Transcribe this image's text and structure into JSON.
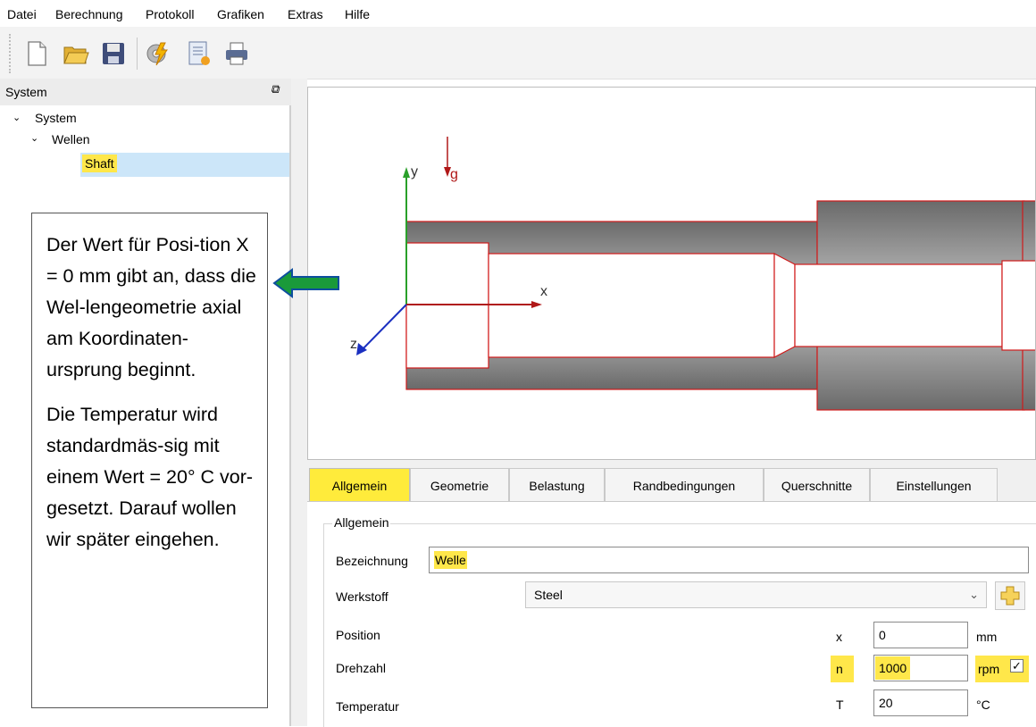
{
  "menu": [
    "Datei",
    "Berechnung",
    "Protokoll",
    "Grafiken",
    "Extras",
    "Hilfe"
  ],
  "toolbar_icons": [
    "new-file-icon",
    "open-folder-icon",
    "save-icon",
    "calculate-icon",
    "report-icon",
    "print-icon"
  ],
  "system_panel": {
    "title": "System",
    "tree": {
      "root": "System",
      "group": "Wellen",
      "item": "Shaft"
    }
  },
  "viewport": {
    "axis_y": "y",
    "axis_x": "x",
    "axis_z": "z",
    "gravity": "g",
    "colors": {
      "x_axis": "#b01818",
      "y_axis": "#2aa02a",
      "z_axis": "#1a2fc0",
      "outline": "#d01a1a",
      "shaft_fill": "#7a7a7a"
    }
  },
  "callout": {
    "para1": "Der Wert für Posi-tion X = 0 mm gibt an, dass die Wel-lengeometrie axial am Koordinaten-ursprung beginnt.",
    "para2": "Die Temperatur wird standardmäs-sig mit einem Wert = 20° C vor-gesetzt. Darauf wollen wir später eingehen.",
    "arrow_color": "#1a9a3a"
  },
  "tabs": [
    "Allgemein",
    "Geometrie",
    "Belastung",
    "Randbedingungen",
    "Querschnitte",
    "Einstellungen"
  ],
  "active_tab": "Allgemein",
  "form": {
    "group_title": "Allgemein",
    "bezeichnung_label": "Bezeichnung",
    "bezeichnung_value": "Welle",
    "werkstoff_label": "Werkstoff",
    "werkstoff_value": "Steel",
    "position_label": "Position",
    "position_symbol": "x",
    "position_value": "0",
    "position_unit": "mm",
    "drehzahl_label": "Drehzahl",
    "drehzahl_symbol": "n",
    "drehzahl_value": "1000",
    "drehzahl_unit": "rpm",
    "temperatur_label": "Temperatur",
    "temperatur_symbol": "T",
    "temperatur_value": "20",
    "temperatur_unit": "°C"
  },
  "highlight_color": "#ffe74a"
}
